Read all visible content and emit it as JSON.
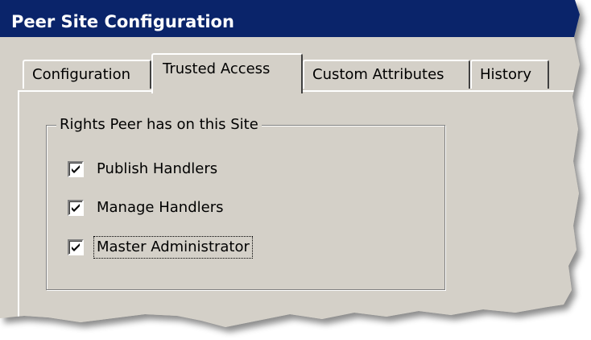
{
  "window": {
    "title": "Peer Site Configuration"
  },
  "colors": {
    "title_bar": "#0a246a",
    "dialog_face": "#d4d0c8"
  },
  "tabs": [
    {
      "label": "Configuration",
      "active": false
    },
    {
      "label": "Trusted Access",
      "active": true
    },
    {
      "label": "Custom Attributes",
      "active": false
    },
    {
      "label": "History",
      "active": false
    }
  ],
  "group": {
    "title": "Rights Peer has on this Site",
    "items": [
      {
        "label": "Publish Handlers",
        "checked": true
      },
      {
        "label": "Manage Handlers",
        "checked": true
      },
      {
        "label": "Master Administrator",
        "checked": true,
        "focused": true
      }
    ]
  }
}
